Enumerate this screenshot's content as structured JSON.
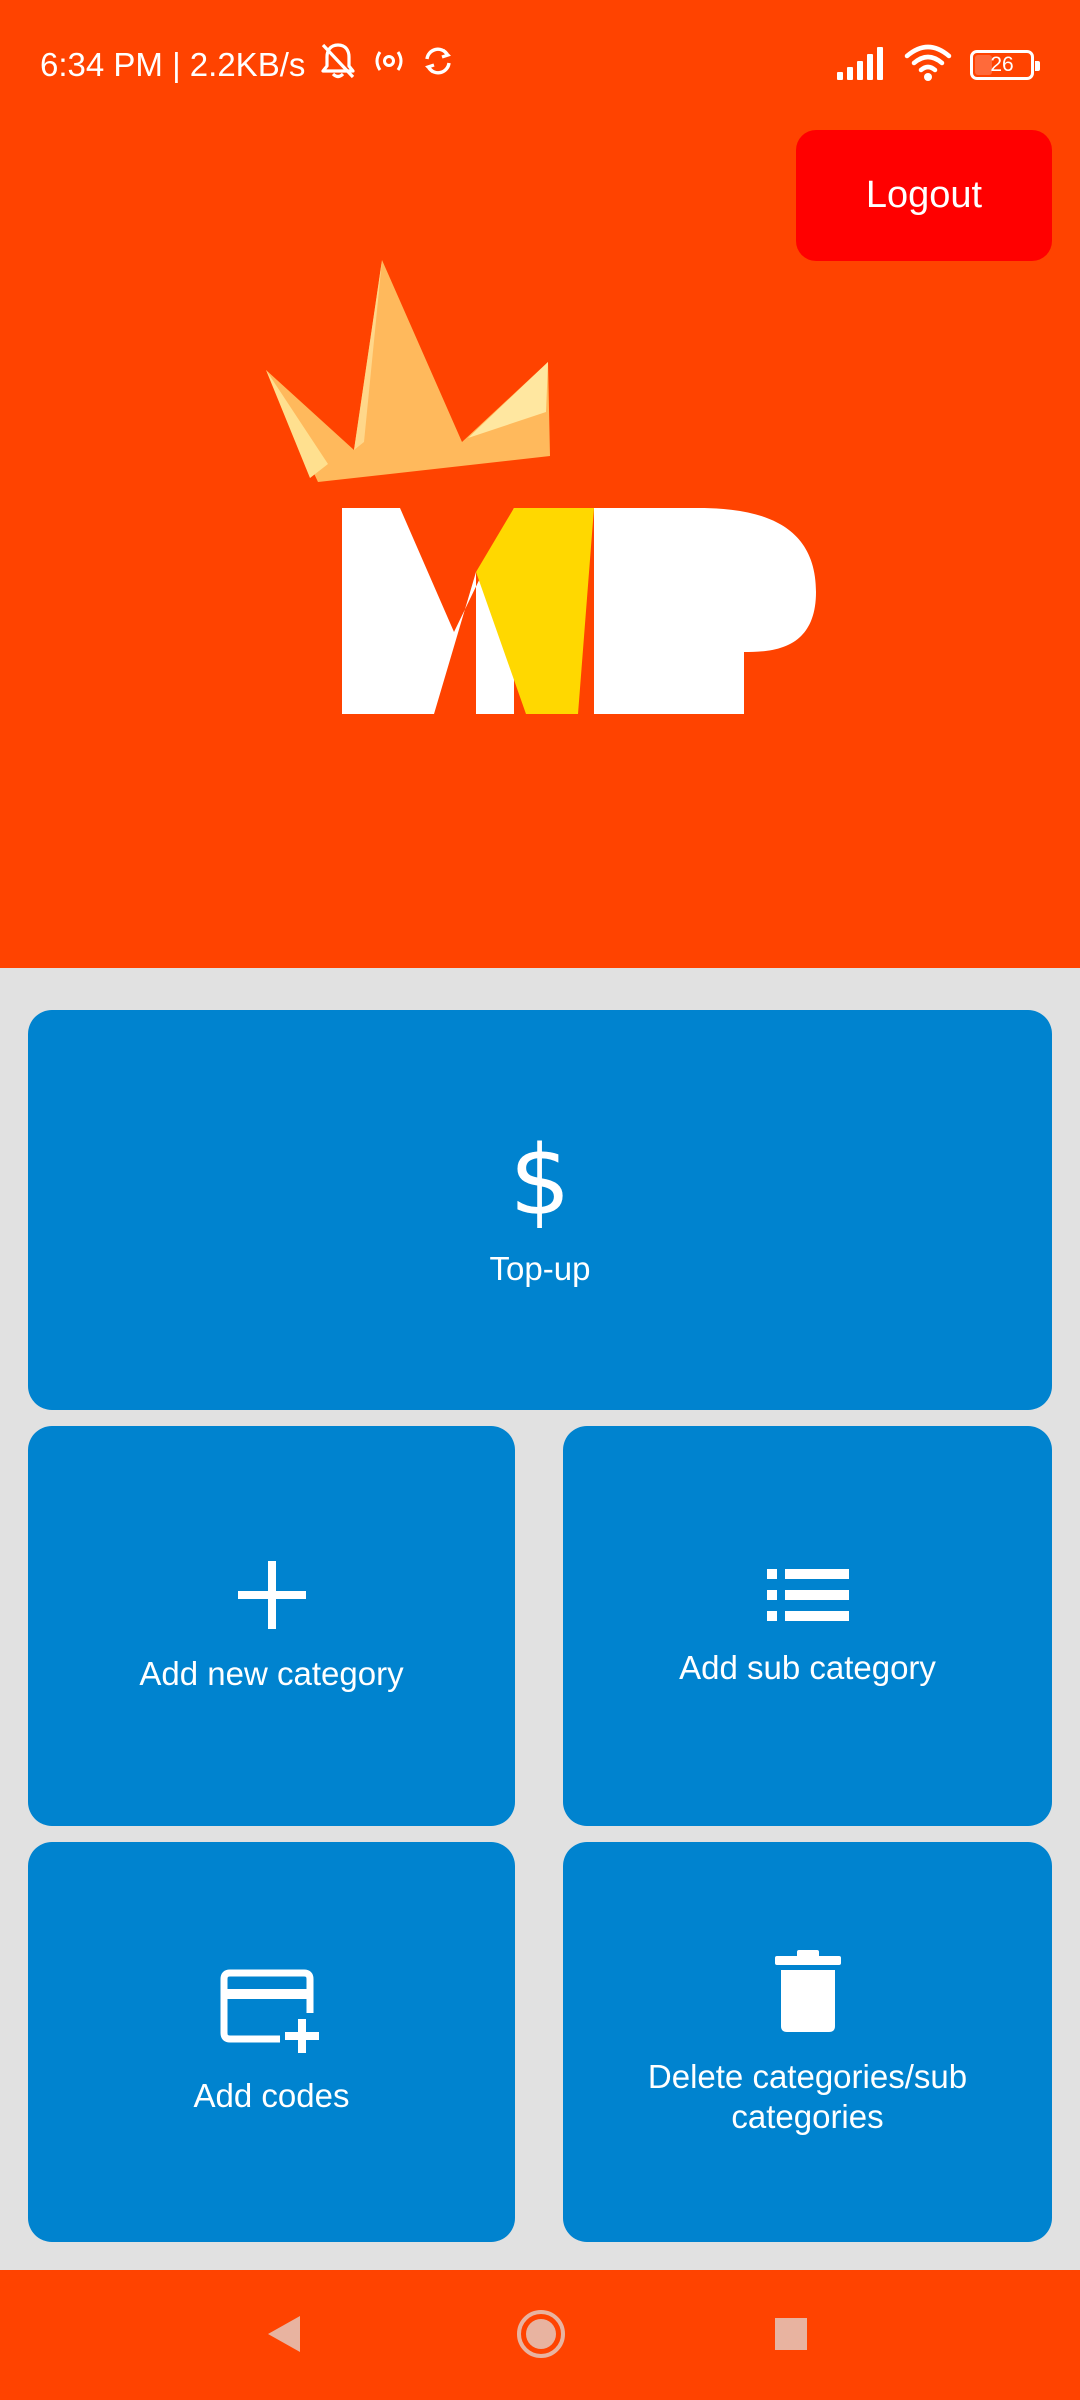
{
  "status_bar": {
    "time_speed": "6:34 PM | 2.2KB/s",
    "battery_level": "26",
    "icons": [
      "mute-bell-icon",
      "hotspot-icon",
      "sync-icon",
      "signal-icon",
      "wifi-icon",
      "battery-icon"
    ]
  },
  "header": {
    "logout_label": "Logout",
    "logo_name": "mvp-crown-logo",
    "logo_text": "MVP",
    "background_color": "#ff4300"
  },
  "tiles": [
    {
      "label": "Top-up",
      "icon": "dollar-icon",
      "glyph": "$"
    },
    {
      "label": "Add new category",
      "icon": "plus-icon"
    },
    {
      "label": "Add sub category",
      "icon": "list-icon"
    },
    {
      "label": "Add codes",
      "icon": "card-add-icon"
    },
    {
      "label": "Delete categories/sub categories",
      "icon": "trash-icon"
    }
  ],
  "colors": {
    "header": "#ff4300",
    "logout": "#ff0000",
    "tile": "#0083cf",
    "background": "#e1e1e1",
    "crown": "#ffb95c",
    "logo_v": "#ffd800"
  },
  "nav_bar": {
    "icons": [
      "back-icon",
      "home-icon",
      "recents-icon"
    ]
  }
}
